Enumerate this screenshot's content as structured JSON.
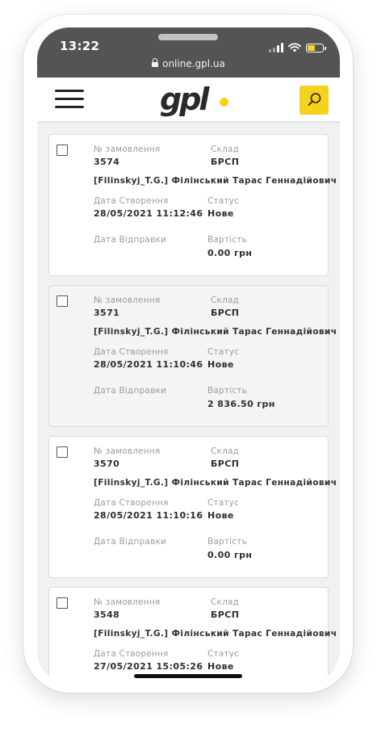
{
  "status_bar": {
    "time": "13:22"
  },
  "browser": {
    "url": "online.gpl.ua"
  },
  "header": {
    "logo": "gpl",
    "brand_accent": "#f5d21c"
  },
  "labels": {
    "order_no": "№ замовлення",
    "warehouse": "Склад",
    "created": "Дата Створення",
    "status": "Статус",
    "shipped": "Дата Відправки",
    "cost": "Вартість"
  },
  "orders": [
    {
      "number": "3574",
      "warehouse": "БРСП",
      "customer": "[Filinskyj_T.G.] Філінський Тарас Геннадійович",
      "created": "28/05/2021 11:12:46",
      "status": "Нове",
      "shipped": "",
      "cost": "0.00 грн"
    },
    {
      "number": "3571",
      "warehouse": "БРСП",
      "customer": "[Filinskyj_T.G.] Філінський Тарас Геннадійович",
      "created": "28/05/2021 11:10:46",
      "status": "Нове",
      "shipped": "",
      "cost": "2 836.50 грн"
    },
    {
      "number": "3570",
      "warehouse": "БРСП",
      "customer": "[Filinskyj_T.G.] Філінський Тарас Геннадійович",
      "created": "28/05/2021 11:10:16",
      "status": "Нове",
      "shipped": "",
      "cost": "0.00 грн"
    },
    {
      "number": "3548",
      "warehouse": "БРСП",
      "customer": "[Filinskyj_T.G.] Філінський Тарас Геннадійович",
      "created": "27/05/2021 15:05:26",
      "status": "Нове",
      "shipped": "",
      "cost": ""
    }
  ]
}
